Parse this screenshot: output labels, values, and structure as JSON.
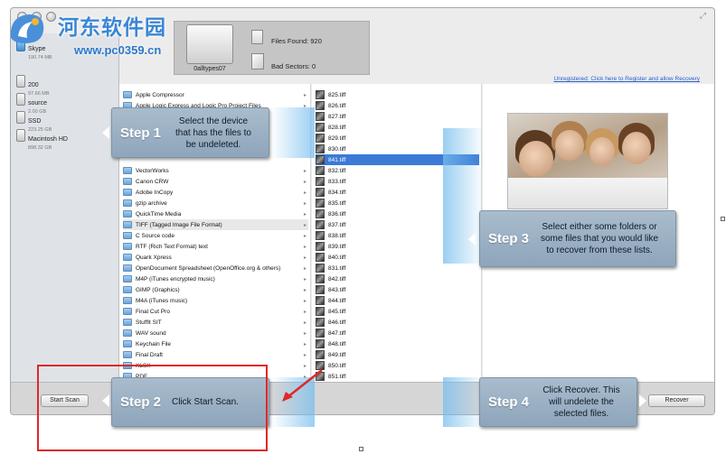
{
  "watermark": {
    "title": "河东软件园",
    "url": "www.pc0359.cn"
  },
  "header": {
    "drive_name": "0alltypes07",
    "files_found_label": "Files Found:",
    "files_found_value": "920",
    "bad_sectors_label": "Bad Sectors:",
    "bad_sectors_value": "0",
    "register_link": "Unregistered: Click here to Register and allow Recovery"
  },
  "sidebar": {
    "devices": [
      {
        "name": "Skype",
        "size": "190.74 MB",
        "icon": "blue-drive-icon"
      },
      {
        "name": "200",
        "size": "97.66 MB",
        "icon": "drive-icon"
      },
      {
        "name": "source",
        "size": "2.00 GB",
        "icon": "drive-icon"
      },
      {
        "name": "SSD",
        "size": "223.25 GB",
        "icon": "drive-icon"
      },
      {
        "name": "Macintosh HD",
        "size": "898.32 GB",
        "icon": "drive-icon"
      }
    ]
  },
  "folders": [
    "Apple Compressor",
    "Apple Logic Express and Logic Pro Project Files",
    "VectorWorks",
    "Canon CRW",
    "Adobe InCopy",
    "gzip archive",
    "QuickTime Media",
    "TIFF (Tagged Image File Format)",
    "C Source code",
    "RTF (Rich Text Format) text",
    "Quark Xpress",
    "OpenDocument Spreadsheet (OpenOffice.org & others)",
    "M4P (iTunes encrypted music)",
    "GIMP (Graphics)",
    "M4A (iTunes music)",
    "Final Cut Pro",
    "StuffIt SIT",
    "WAV sound",
    "Keychain File",
    "Final Draft",
    "XLSX",
    "PDF"
  ],
  "selected_folder": "TIFF (Tagged Image File Format)",
  "files": [
    "825.tiff",
    "826.tiff",
    "827.tiff",
    "828.tiff",
    "829.tiff",
    "830.tiff",
    "841.tiff",
    "832.tiff",
    "833.tiff",
    "834.tiff",
    "835.tiff",
    "836.tiff",
    "837.tiff",
    "838.tiff",
    "839.tiff",
    "840.tiff",
    "831.tiff",
    "842.tiff",
    "843.tiff",
    "844.tiff",
    "845.tiff",
    "846.tiff",
    "847.tiff",
    "848.tiff",
    "849.tiff",
    "850.tiff",
    "851.tiff"
  ],
  "selected_file": "841.tiff",
  "buttons": {
    "start_scan": "Start Scan",
    "recover": "Recover"
  },
  "steps": [
    {
      "label": "Step 1",
      "text": "Select the device that has the files to be undeleted."
    },
    {
      "label": "Step 2",
      "text": "Click Start Scan."
    },
    {
      "label": "Step 3",
      "text": "Select either some folders or some files that you would like to recover from these lists."
    },
    {
      "label": "Step 4",
      "text": "Click Recover. This will undelete the selected files."
    }
  ],
  "colors": {
    "callout": "#9bb0c4",
    "selection": "#3b7ad6",
    "highlight": "#e02828",
    "watermark": "#3a86d6"
  }
}
